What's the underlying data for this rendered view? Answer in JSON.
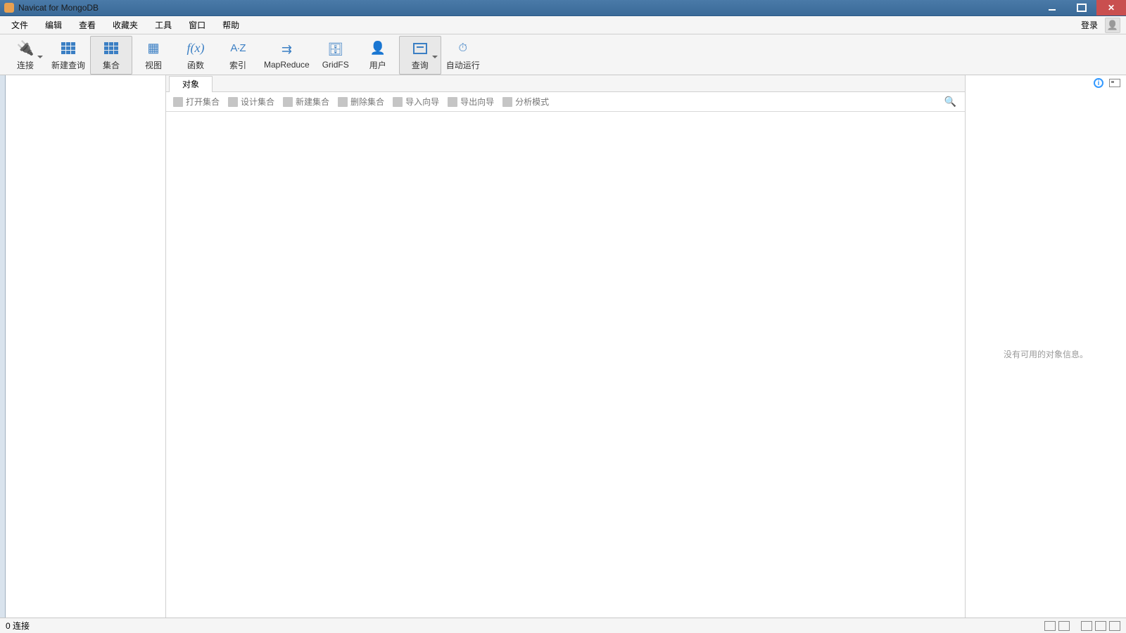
{
  "window": {
    "title": "Navicat for MongoDB"
  },
  "menu": {
    "items": [
      "文件",
      "编辑",
      "查看",
      "收藏夹",
      "工具",
      "窗口",
      "帮助"
    ],
    "login": "登录"
  },
  "toolbar": {
    "items": [
      {
        "id": "connect",
        "label": "连接",
        "dropdown": true,
        "active": false
      },
      {
        "id": "new-query",
        "label": "新建查询",
        "dropdown": false,
        "active": false
      },
      {
        "id": "collection",
        "label": "集合",
        "dropdown": false,
        "active": true
      },
      {
        "id": "view",
        "label": "视图",
        "dropdown": false,
        "active": false
      },
      {
        "id": "function",
        "label": "函数",
        "dropdown": false,
        "active": false
      },
      {
        "id": "index",
        "label": "索引",
        "dropdown": false,
        "active": false
      },
      {
        "id": "mapreduce",
        "label": "MapReduce",
        "dropdown": false,
        "active": false
      },
      {
        "id": "gridfs",
        "label": "GridFS",
        "dropdown": false,
        "active": false
      },
      {
        "id": "user",
        "label": "用户",
        "dropdown": false,
        "active": false
      },
      {
        "id": "query",
        "label": "查询",
        "dropdown": true,
        "active": true
      },
      {
        "id": "autorun",
        "label": "自动运行",
        "dropdown": false,
        "active": false
      }
    ]
  },
  "tabs": {
    "object": "对象"
  },
  "subtoolbar": {
    "open": "打开集合",
    "design": "设计集合",
    "new": "新建集合",
    "delete": "删除集合",
    "import": "导入向导",
    "export": "导出向导",
    "analyze": "分析模式"
  },
  "right": {
    "empty": "没有可用的对象信息。"
  },
  "status": {
    "connections": "0 连接"
  }
}
